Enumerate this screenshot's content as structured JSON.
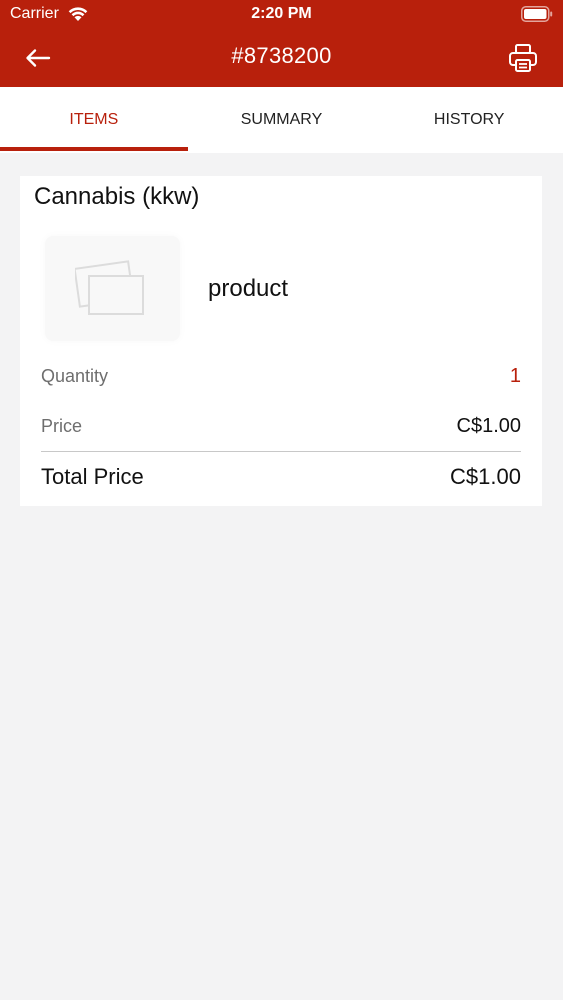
{
  "status_bar": {
    "carrier": "Carrier",
    "time": "2:20 PM"
  },
  "nav": {
    "title": "#8738200"
  },
  "tabs": [
    {
      "label": "ITEMS",
      "active": true
    },
    {
      "label": "SUMMARY",
      "active": false
    },
    {
      "label": "HISTORY",
      "active": false
    }
  ],
  "item": {
    "category": "Cannabis (kkw)",
    "name": "product",
    "quantity_label": "Quantity",
    "quantity": "1",
    "price_label": "Price",
    "price": "C$1.00",
    "total_label": "Total Price",
    "total": "C$1.00"
  },
  "colors": {
    "accent": "#b8200c",
    "background": "#f3f3f4",
    "card": "#ffffff"
  },
  "icons": {
    "back": "arrow-left-icon",
    "print": "printer-icon",
    "wifi": "wifi-icon",
    "battery": "battery-icon",
    "placeholder": "image-placeholder-icon"
  }
}
